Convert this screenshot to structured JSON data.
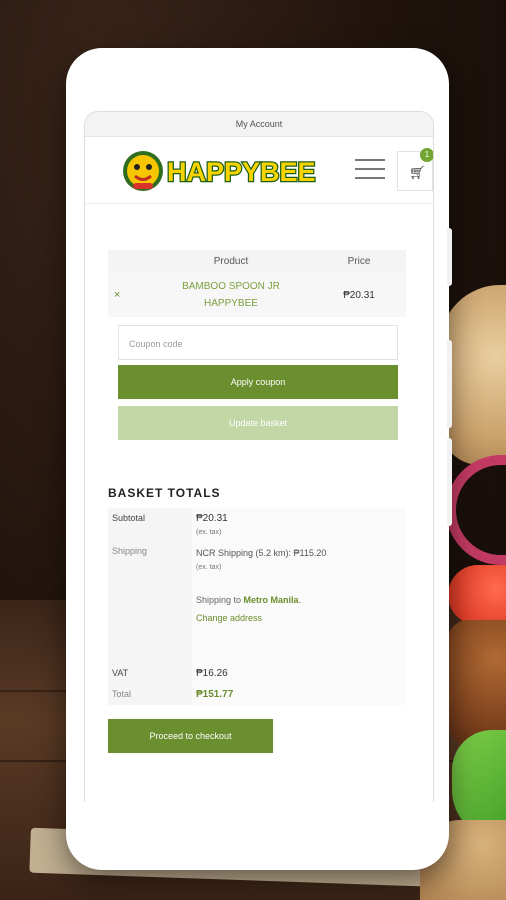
{
  "colors": {
    "accent": "#6b8e2f",
    "accent_light": "#c3d6a6",
    "badge": "#72a532"
  },
  "topbar": {
    "title": "My Account"
  },
  "header": {
    "logo_text": "HAPPYBEE",
    "cart_count": "1"
  },
  "cart_table": {
    "headers": [
      "Product",
      "Price"
    ],
    "rows": [
      {
        "remove": "×",
        "product_line1": "BAMBOO SPOON JR",
        "product_line2": "HAPPYBEE",
        "price": "₱20.31"
      }
    ]
  },
  "coupon": {
    "placeholder": "Coupon code",
    "apply_label": "Apply coupon",
    "update_label": "Update basket"
  },
  "totals": {
    "title": "BASKET TOTALS",
    "subtotal_label": "Subtotal",
    "subtotal_value": "₱20.31",
    "subtotal_note": "(ex. tax)",
    "shipping_label": "Shipping",
    "shipping_value": "NCR Shipping (5.2 km): ₱115.20",
    "shipping_note": "(ex. tax)",
    "shipping_to_prefix": "Shipping to ",
    "shipping_to_place": "Metro Manila",
    "shipping_to_suffix": ".",
    "change_address": "Change address",
    "vat_label": "VAT",
    "vat_value": "₱16.26",
    "total_label": "Total",
    "total_value": "₱151.77"
  },
  "checkout": {
    "label": "Proceed to checkout"
  }
}
